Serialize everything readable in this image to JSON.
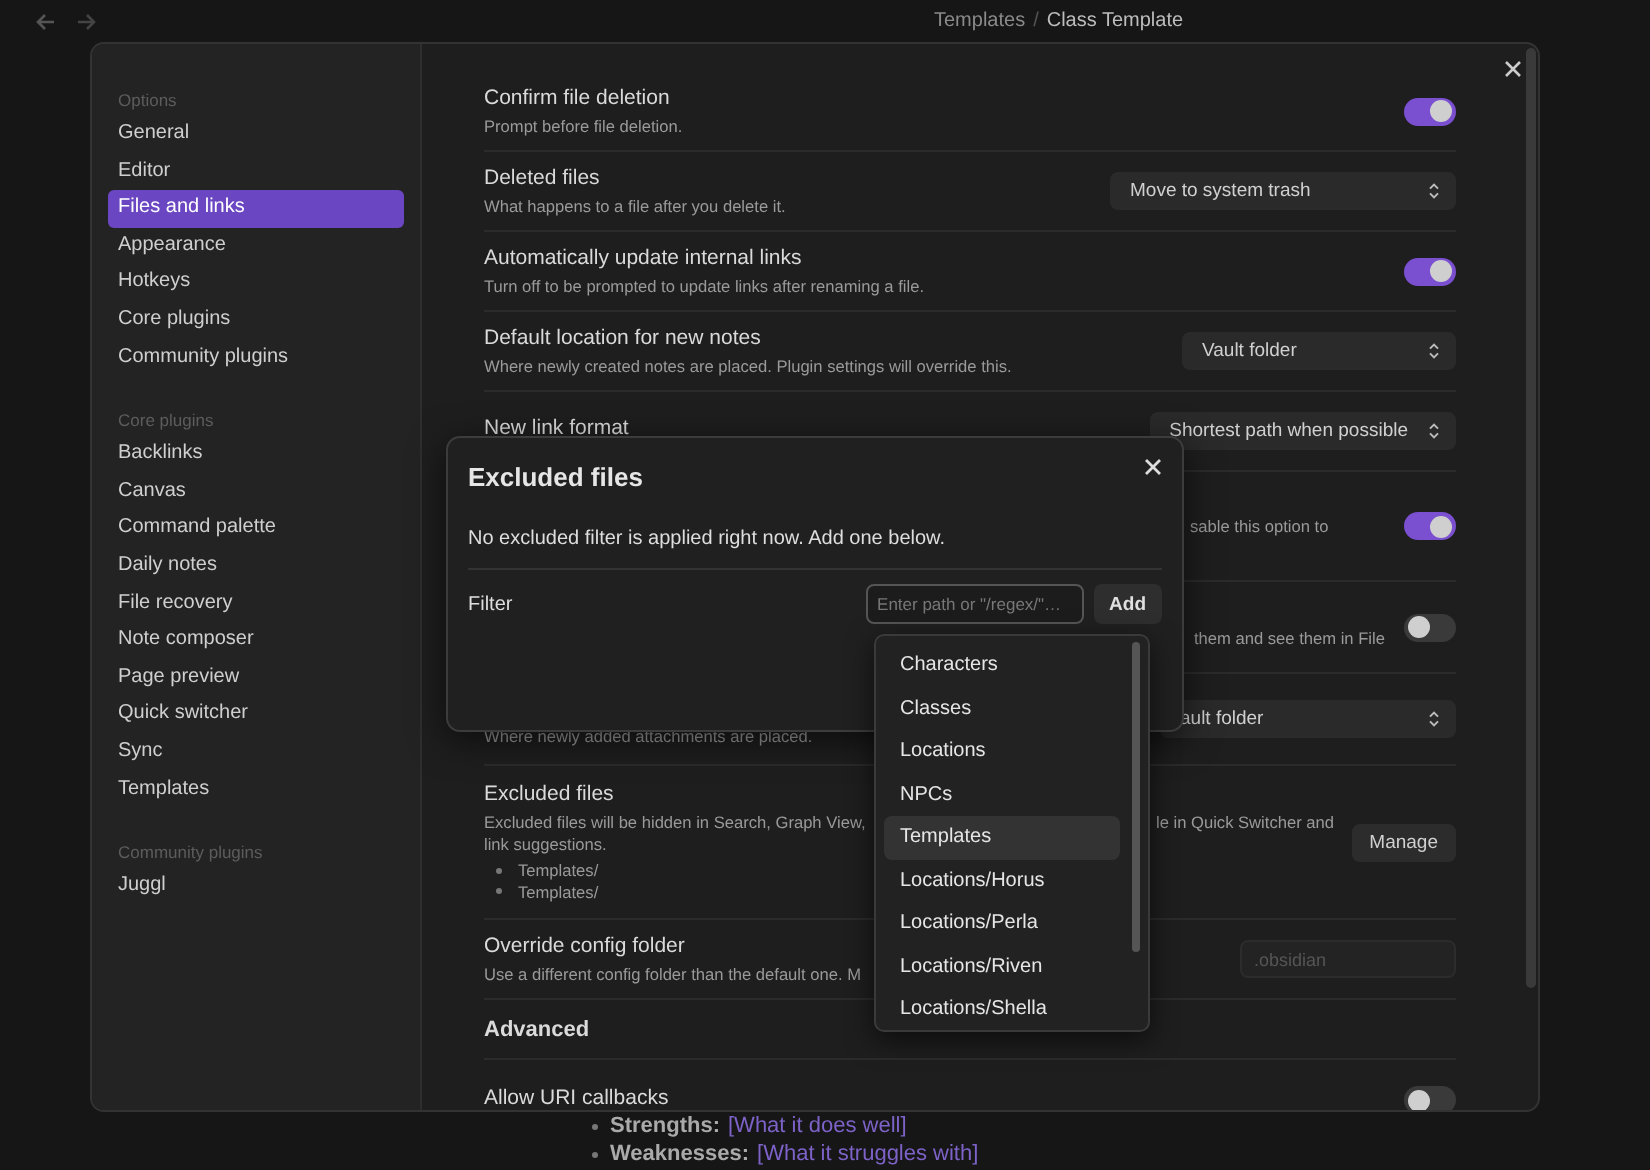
{
  "breadcrumb": {
    "parent": "Templates",
    "separator": "/",
    "current": "Class Template"
  },
  "sidebar": {
    "sections": [
      {
        "heading": "Options",
        "items": [
          {
            "label": "General",
            "selected": false
          },
          {
            "label": "Editor",
            "selected": false
          },
          {
            "label": "Files and links",
            "selected": true
          },
          {
            "label": "Appearance",
            "selected": false
          },
          {
            "label": "Hotkeys",
            "selected": false
          },
          {
            "label": "Core plugins",
            "selected": false
          },
          {
            "label": "Community plugins",
            "selected": false
          }
        ]
      },
      {
        "heading": "Core plugins",
        "items": [
          {
            "label": "Backlinks",
            "selected": false
          },
          {
            "label": "Canvas",
            "selected": false
          },
          {
            "label": "Command palette",
            "selected": false
          },
          {
            "label": "Daily notes",
            "selected": false
          },
          {
            "label": "File recovery",
            "selected": false
          },
          {
            "label": "Note composer",
            "selected": false
          },
          {
            "label": "Page preview",
            "selected": false
          },
          {
            "label": "Quick switcher",
            "selected": false
          },
          {
            "label": "Sync",
            "selected": false
          },
          {
            "label": "Templates",
            "selected": false
          }
        ]
      },
      {
        "heading": "Community plugins",
        "items": [
          {
            "label": "Juggl",
            "selected": false
          }
        ]
      }
    ]
  },
  "settings": [
    {
      "kind": "toggle",
      "title": "Confirm file deletion",
      "description": "Prompt before file deletion.",
      "on": true
    },
    {
      "kind": "dropdown",
      "title": "Deleted files",
      "description": "What happens to a file after you delete it.",
      "value": "Move to system trash"
    },
    {
      "kind": "toggle",
      "title": "Automatically update internal links",
      "description": "Turn off to be prompted to update links after renaming a file.",
      "on": true
    },
    {
      "kind": "dropdown",
      "title": "Default location for new notes",
      "description": "Where newly created notes are placed. Plugin settings will override this.",
      "value": "Vault folder"
    },
    {
      "kind": "dropdown",
      "title": "New link format",
      "value": "Shortest path when possible"
    },
    {
      "kind": "toggle",
      "description_tail": "sable this option to",
      "on": true
    },
    {
      "kind": "toggle",
      "description_tail": "them and see them in File",
      "on": false
    },
    {
      "kind": "dropdown",
      "description": "Where newly added attachments are placed.",
      "value": "ault folder"
    },
    {
      "kind": "button",
      "title": "Excluded files",
      "description_parts": [
        "Excluded files will be hidden in Search, Graph View,",
        "le in Quick Switcher and",
        "link suggestions."
      ],
      "list": [
        "Templates/",
        "Templates/"
      ],
      "button": "Manage"
    },
    {
      "kind": "input",
      "title": "Override config folder",
      "description": "Use a different config folder than the default one. M",
      "placeholder": ".obsidian"
    },
    {
      "kind": "heading",
      "title": "Advanced"
    },
    {
      "kind": "toggle",
      "title": "Allow URI callbacks",
      "on": false
    }
  ],
  "dialog": {
    "title": "Excluded files",
    "message": "No excluded filter is applied right now. Add one below.",
    "filter_label": "Filter",
    "placeholder": "Enter path or \"/regex/\"…",
    "add_button": "Add"
  },
  "suggestions": [
    {
      "label": "Characters",
      "selected": false
    },
    {
      "label": "Classes",
      "selected": false
    },
    {
      "label": "Locations",
      "selected": false
    },
    {
      "label": "NPCs",
      "selected": false
    },
    {
      "label": "Templates",
      "selected": true
    },
    {
      "label": "Locations/Horus",
      "selected": false
    },
    {
      "label": "Locations/Perla",
      "selected": false
    },
    {
      "label": "Locations/Riven",
      "selected": false
    },
    {
      "label": "Locations/Shella",
      "selected": false
    }
  ],
  "note_lines": [
    {
      "label": "Strengths:",
      "value": "[What it does well]"
    },
    {
      "label": "Weaknesses:",
      "value": "[What it struggles with]"
    }
  ]
}
